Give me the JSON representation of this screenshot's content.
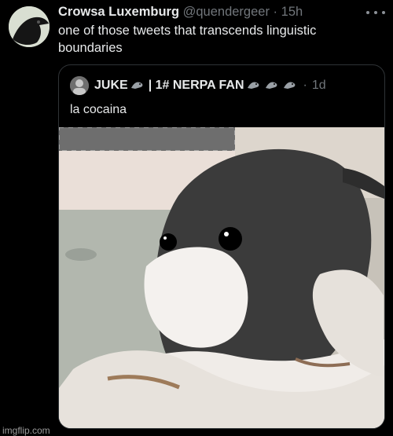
{
  "tweet": {
    "author_name": "Crowsa Luxemburg",
    "handle": "@quendergeer",
    "separator": "·",
    "time": "15h",
    "text": "one of those tweets that transcends linguistic boundaries"
  },
  "quote": {
    "author_name_start": "JUKE",
    "author_name_mid": "| 1# NERPA FAN",
    "separator": "·",
    "time": "1d",
    "text": "la cocaina",
    "author_icon": "seal-icon"
  },
  "watermark": "imgflip.com"
}
